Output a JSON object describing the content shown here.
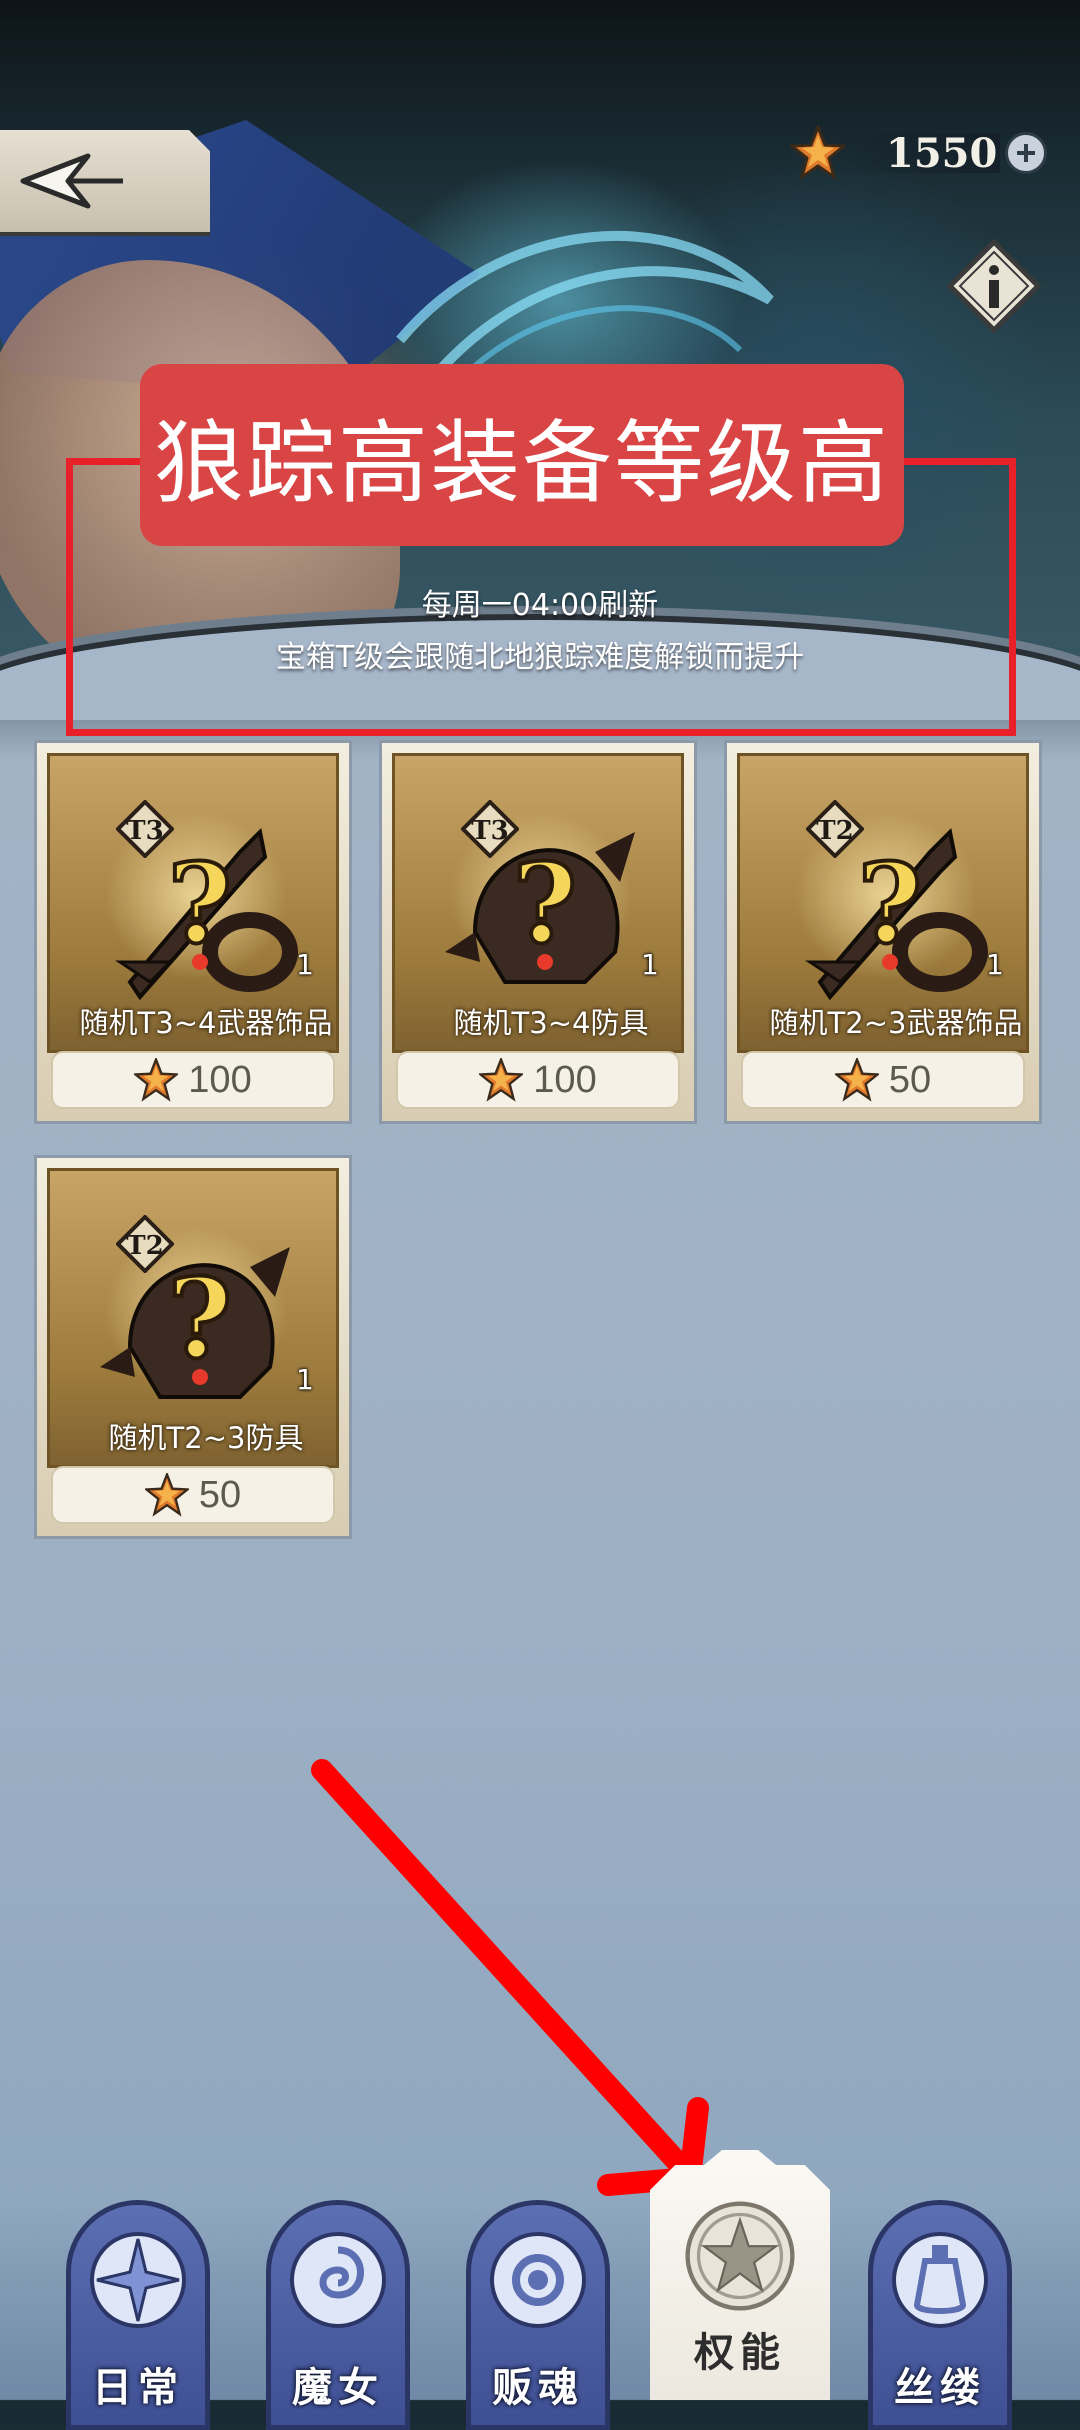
{
  "header": {
    "currency_icon": "star-coin-icon",
    "currency_amount": "1550",
    "back_icon": "back-arrow-icon",
    "plus_icon": "plus-icon",
    "info_icon": "info-icon"
  },
  "annotation": {
    "title": "狼踪高装备等级高",
    "box_color": "#e8202a",
    "title_bg": "#d94545"
  },
  "notice": {
    "line1": "每周一04:00刷新",
    "line2": "宝箱T级会跟随北地狼踪难度解锁而提升"
  },
  "cards": [
    {
      "tier": "T3",
      "name": "随机T3~4武器饰品",
      "count": "1",
      "price": "100",
      "item_icon": "weapon-accessory-mystery-icon"
    },
    {
      "tier": "T3",
      "name": "随机T3~4防具",
      "count": "1",
      "price": "100",
      "item_icon": "armor-mystery-icon"
    },
    {
      "tier": "T2",
      "name": "随机T2~3武器饰品",
      "count": "1",
      "price": "50",
      "item_icon": "weapon-accessory-mystery-icon"
    },
    {
      "tier": "T2",
      "name": "随机T2~3防具",
      "count": "1",
      "price": "50",
      "item_icon": "armor-mystery-icon"
    }
  ],
  "tabs": [
    {
      "label": "日常",
      "icon": "compass-star-icon",
      "active": false
    },
    {
      "label": "魔女",
      "icon": "swirl-rose-icon",
      "active": false
    },
    {
      "label": "贩魂",
      "icon": "rose-icon",
      "active": false
    },
    {
      "label": "权能",
      "icon": "star-medallion-icon",
      "active": true
    },
    {
      "label": "丝缕",
      "icon": "potion-bottle-icon",
      "active": false
    }
  ],
  "arrow_color": "#ff0000"
}
